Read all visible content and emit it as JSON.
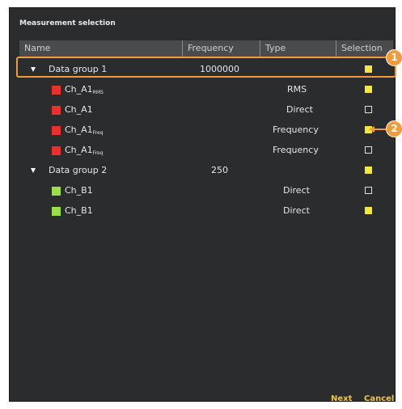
{
  "dialog": {
    "title": "Measurement selection",
    "columns": {
      "name": "Name",
      "frequency": "Frequency",
      "type": "Type",
      "selection": "Selection"
    },
    "rows": [
      {
        "name": "Data group 1",
        "sub": "",
        "frequency": "1000000",
        "type": "",
        "selected": true,
        "group": true,
        "color": ""
      },
      {
        "name": "Ch_A1",
        "sub": "RMS",
        "frequency": "",
        "type": "RMS",
        "selected": true,
        "group": false,
        "color": "#e8302c"
      },
      {
        "name": "Ch_A1",
        "sub": "",
        "frequency": "",
        "type": "Direct",
        "selected": false,
        "group": false,
        "color": "#e8302c"
      },
      {
        "name": "Ch_A1",
        "sub": "Freq",
        "frequency": "",
        "type": "Frequency",
        "selected": true,
        "group": false,
        "color": "#e8302c"
      },
      {
        "name": "Ch_A1",
        "sub": "Freq",
        "frequency": "",
        "type": "Frequency",
        "selected": false,
        "group": false,
        "color": "#e8302c"
      },
      {
        "name": "Data group 2",
        "sub": "",
        "frequency": "250",
        "type": "",
        "selected": true,
        "group": true,
        "color": ""
      },
      {
        "name": "Ch_B1",
        "sub": "",
        "frequency": "",
        "type": "Direct",
        "selected": false,
        "group": false,
        "color": "#9be04a"
      },
      {
        "name": "Ch_B1",
        "sub": "",
        "frequency": "",
        "type": "Direct",
        "selected": true,
        "group": false,
        "color": "#9be04a"
      }
    ],
    "buttons": {
      "next": "Next",
      "cancel": "Cancel"
    }
  },
  "callouts": {
    "first": "1",
    "second": "2"
  },
  "colors": {
    "accent": "#f19b3a",
    "checkbox_on": "#f5e63c",
    "button_text": "#f5c63c"
  }
}
